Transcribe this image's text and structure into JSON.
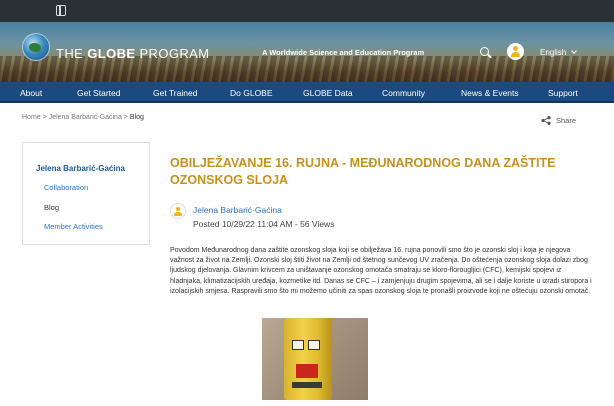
{
  "header": {
    "brand_thin": "THE ",
    "brand_bold": "GLOBE",
    "brand_rest": " PROGRAM",
    "tagline": "A Worldwide Science and Education Program",
    "language": "English"
  },
  "nav": {
    "items": [
      "About",
      "Get Started",
      "Get Trained",
      "Do GLOBE",
      "GLOBE Data",
      "Community",
      "News & Events",
      "Support"
    ]
  },
  "breadcrumb": {
    "home": "Home",
    "sep": ">",
    "author": "Jelena Barbarić-Gaćina",
    "current": "Blog"
  },
  "share_label": "Share",
  "sidebar": {
    "title": "Jelena Barbarić-Gaćina",
    "items": [
      "Collaboration",
      "Blog",
      "Member Activities"
    ]
  },
  "post": {
    "title": "OBILJEŽAVANJE 16. RUJNA - MEĐUNARODNOG DANA ZAŠTITE OZONSKOG SLOJA",
    "author": "Jelena Barbarić-Gaćina",
    "meta": "Posted 10/29/22 11:04 AM - 56 Views",
    "body": "Povodom Međunarodnog dana zaštite ozonskog sloja koji se obilježava 16. rujna ponovili smo što je ozonski sloj i koja je njegova važnost za život na Zemlji. Ozonski sloj štiti život na Zemlji od štetnog sunčevog UV zračenja. Do oštećenja ozonskog sloja dolazi zbog ljudskog djelovanja. Glavnim krivcem za uništavanje ozonskog omotača smatraju se kloro-florougljici (CFC), kemijski spojevi iz hladnjaka, klimatizacijskih uređaja, kozmetike itd. Danas se CFC – i zamjenjuju drugim spojevima, ali se i dalje koriste u izradi stiropora i izolacijskih smjesa. Raspravili smo što mi možemo učiniti za spas ozonskog sloja te pronašli proizvode koji ne oštećuju ozonski omotač."
  },
  "colors": {
    "nav_bg": "#1a4a7f",
    "title": "#c8901c",
    "link": "#2b73c4",
    "topbar": "#2b2f36"
  }
}
